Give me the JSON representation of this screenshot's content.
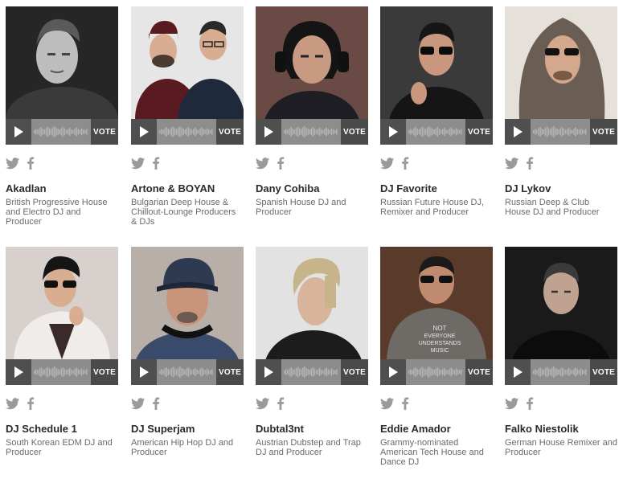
{
  "ui": {
    "vote_label": "VOTE",
    "accent": "#4a4a4a",
    "player_bg": "#8d8d8d"
  },
  "artists": [
    {
      "name": "Akadlan",
      "description": "British Progressive House and Electro DJ and Producer",
      "photo": "bw-portrait",
      "bg": "#c8c8c8"
    },
    {
      "name": "Artone & BOYAN",
      "description": "Bulgarian Deep House & Chillout-Lounge Producers & DJs",
      "photo": "duo-portrait",
      "bg": "#e6e6e6"
    },
    {
      "name": "Dany Cohiba",
      "description": "Spanish House DJ and Producer",
      "photo": "headphones-portrait",
      "bg": "#6a4a44"
    },
    {
      "name": "DJ Favorite",
      "description": "Russian Future House DJ, Remixer and Producer",
      "photo": "sunglasses-portrait",
      "bg": "#3a3a3a"
    },
    {
      "name": "DJ Lykov",
      "description": "Russian Deep & Club House DJ and Producer",
      "photo": "hood-portrait",
      "bg": "#a89a8c"
    },
    {
      "name": "DJ Schedule 1",
      "description": "South Korean EDM DJ and Producer",
      "photo": "jacket-portrait",
      "bg": "#d8d0cc"
    },
    {
      "name": "DJ Superjam",
      "description": "American Hip Hop DJ and Producer",
      "photo": "cap-portrait",
      "bg": "#b8b0a8"
    },
    {
      "name": "Dubtal3nt",
      "description": "Austrian Dubstep and Trap DJ and Producer",
      "photo": "blond-portrait",
      "bg": "#e2e2e2"
    },
    {
      "name": "Eddie Amador",
      "description": "Grammy-nominated American Tech House and Dance DJ",
      "photo": "tshirt-portrait",
      "bg": "#5a3a2a"
    },
    {
      "name": "Falko Niestolik",
      "description": "German House Remixer and Producer",
      "photo": "dark-portrait",
      "bg": "#1a1a1a"
    }
  ]
}
